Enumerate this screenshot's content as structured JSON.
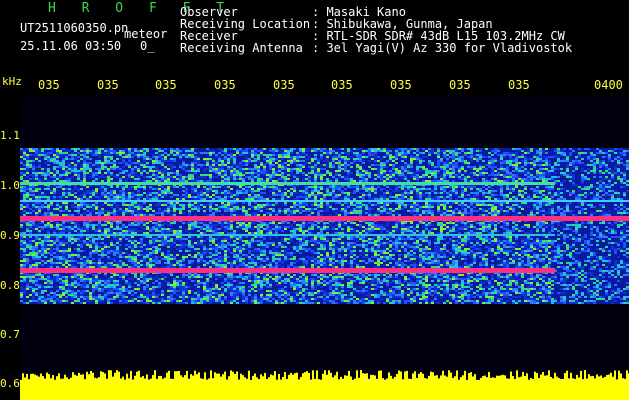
{
  "header": {
    "title": "H R O F F T",
    "filename": "UT2511060350.pn",
    "tag": "meteor",
    "datetime": "25.11.06 03:50",
    "counter": "0_",
    "observer_label": "Observer",
    "observer_value": ": Masaki Kano",
    "location_label": "Receiving Location",
    "location_value": ": Shibukawa, Gunma, Japan",
    "receiver_label": "Receiver",
    "receiver_value": ": RTL-SDR SDR# 43dB L15 103.2MHz CW",
    "antenna_label": "Receiving Antenna",
    "antenna_value": ": 3el Yagi(V) Az 330 for Vladivostok"
  },
  "axis": {
    "unit": "kHz",
    "freq_ticks": [
      "1.1",
      "1.0",
      "0.9",
      "0.8",
      "0.7",
      "0.6"
    ],
    "time_ticks": [
      "035",
      "035",
      "035",
      "035",
      "035",
      "035",
      "035",
      "035",
      "035",
      "0400"
    ]
  },
  "colors": {
    "header_text": "#ffffff",
    "title": "#39d94a",
    "axis_text": "#ffff44",
    "noise_floor": "#ffff00"
  }
}
